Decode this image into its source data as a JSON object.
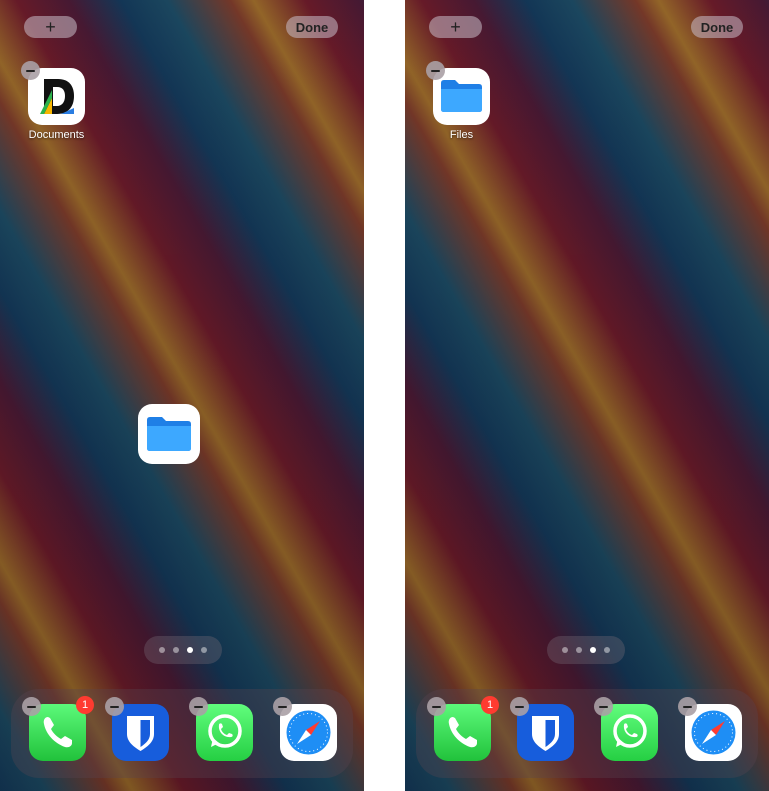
{
  "screens": [
    {
      "top_bar": {
        "add_label": "+",
        "done_label": "Done"
      },
      "apps": [
        {
          "label": "Documents",
          "icon": "documents-icon"
        }
      ],
      "dragging_app": {
        "icon": "files-icon"
      },
      "page_indicator": {
        "count": 4,
        "active_index": 2
      },
      "dock": [
        {
          "icon": "phone-icon",
          "badge": "1"
        },
        {
          "icon": "bitwarden-icon"
        },
        {
          "icon": "whatsapp-icon"
        },
        {
          "icon": "safari-icon"
        }
      ]
    },
    {
      "top_bar": {
        "add_label": "+",
        "done_label": "Done"
      },
      "apps": [
        {
          "label": "Files",
          "icon": "files-icon"
        }
      ],
      "page_indicator": {
        "count": 4,
        "active_index": 2
      },
      "dock": [
        {
          "icon": "phone-icon",
          "badge": "1"
        },
        {
          "icon": "bitwarden-icon"
        },
        {
          "icon": "whatsapp-icon"
        },
        {
          "icon": "safari-icon"
        }
      ]
    }
  ],
  "colors": {
    "badge_red": "#ff3b30",
    "phone_green": "#21c23b",
    "bitwarden_blue": "#175ddc",
    "whatsapp_green": "#25cf43",
    "files_blue": "#1e8ef5"
  }
}
